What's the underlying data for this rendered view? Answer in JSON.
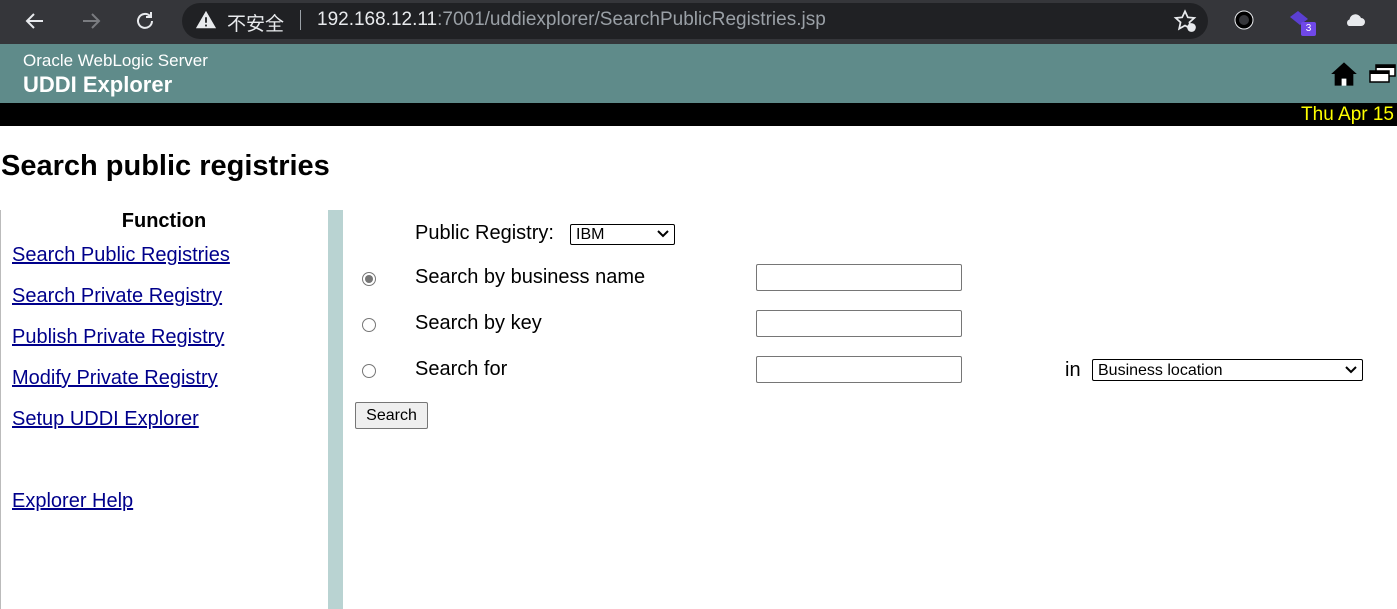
{
  "browser": {
    "security_label": "不安全",
    "url_host": "192.168.12.11",
    "url_rest": ":7001/uddiexplorer/SearchPublicRegistries.jsp",
    "extension_badge": "3"
  },
  "banner": {
    "subtitle": "Oracle WebLogic Server",
    "title": "UDDI Explorer",
    "date": "Thu Apr 15"
  },
  "page": {
    "title": "Search public registries"
  },
  "nav": {
    "heading": "Function",
    "items": [
      "Search Public Registries",
      "Search Private Registry",
      "Publish Private Registry",
      "Modify Private Registry",
      "Setup UDDI Explorer",
      "Explorer Help"
    ]
  },
  "form": {
    "registry_label": "Public Registry:",
    "registry_value": "IBM",
    "by_name_label": "Search by business name",
    "by_key_label": "Search by key",
    "search_for_label": "Search for",
    "in_label": "in",
    "in_value": "Business location",
    "search_button": "Search",
    "selected_option": "Search by business name"
  },
  "colors": {
    "banner": "#5f8b8a",
    "date_text": "#ffff00",
    "link": "#00008b",
    "divider": "#b9d3d2"
  }
}
